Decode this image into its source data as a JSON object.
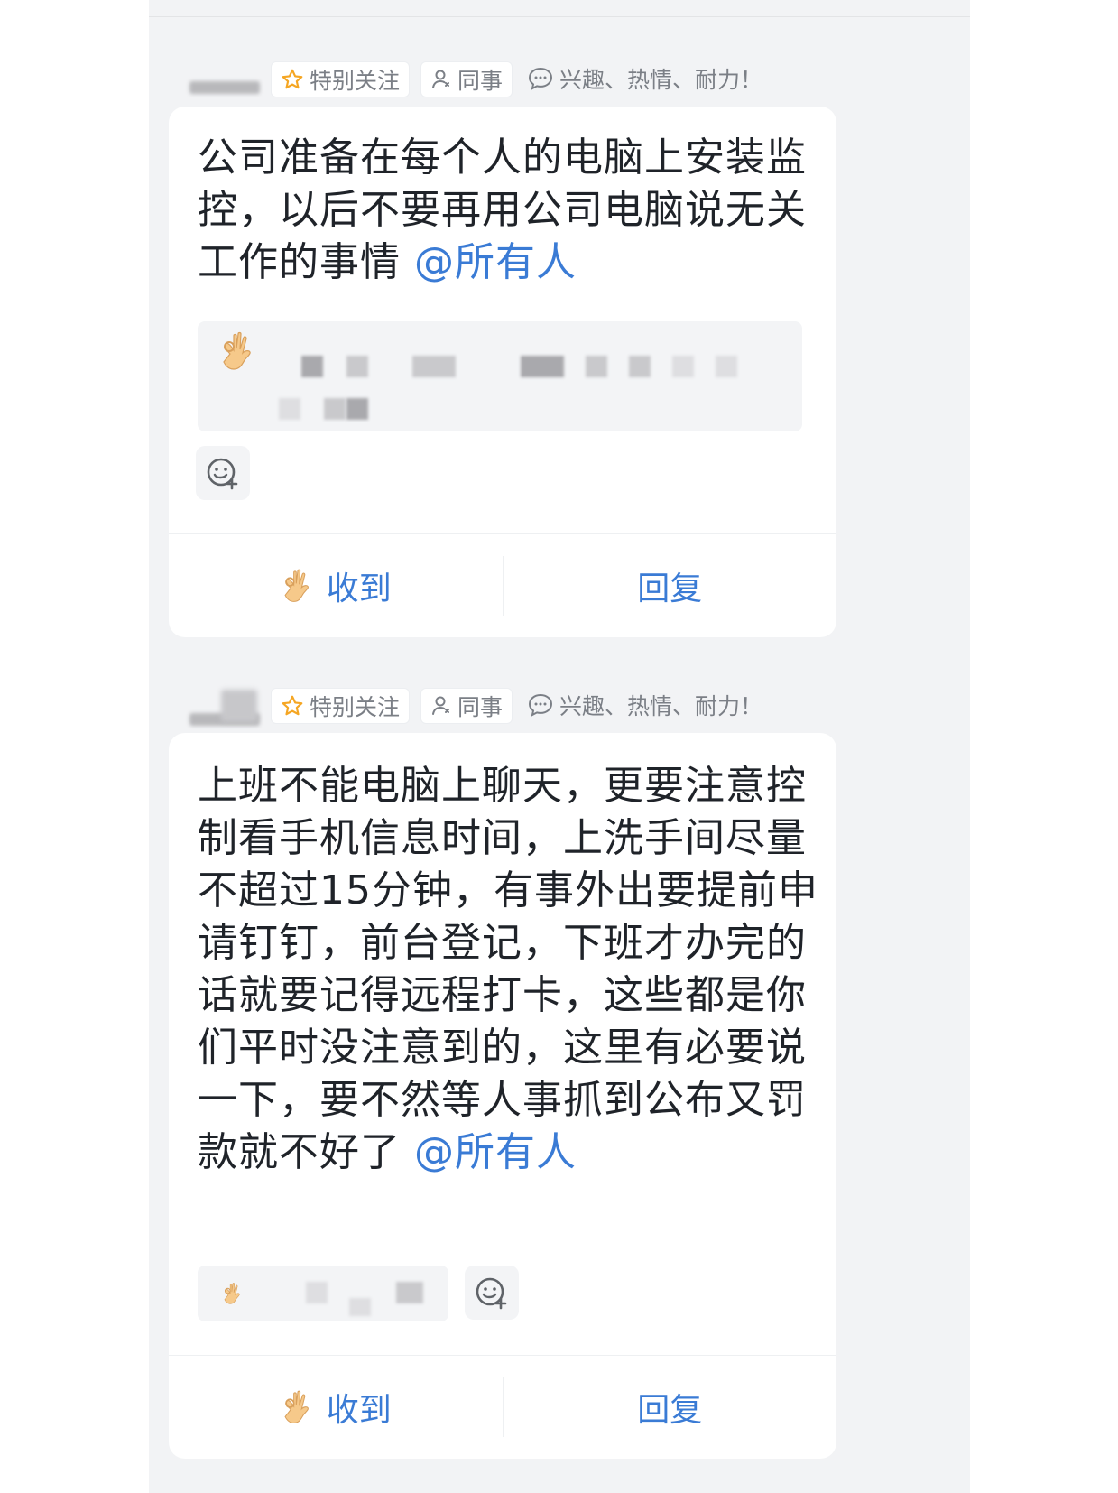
{
  "messages": [
    {
      "tags": {
        "special_follow": "特别关注",
        "colleague": "同事",
        "signature": "兴趣、热情、耐力！"
      },
      "text": "公司准备在每个人的电脑上安装监控，以后不要再用公司电脑说无关工作的事情",
      "mention": "@所有人",
      "reaction_icon": "ok-hand-icon",
      "footer": {
        "received_label": "收到",
        "reply_label": "回复"
      }
    },
    {
      "tags": {
        "special_follow": "特别关注",
        "colleague": "同事",
        "signature": "兴趣、热情、耐力！"
      },
      "text": "上班不能电脑上聊天，更要注意控制看手机信息时间，上洗手间尽量不超过15分钟，有事外出要提前申请钉钉，前台登记，下班才办完的话就要记得远程打卡，这些都是你们平时没注意到的，这里有必要说一下，要不然等人事抓到公布又罚款就不好了",
      "mention": "@所有人",
      "reaction_icon": "ok-hand-icon",
      "footer": {
        "received_label": "收到",
        "reply_label": "回复"
      }
    }
  ],
  "colors": {
    "accent": "#3a7bd5",
    "text": "#1f2329",
    "tag_text": "#7b7f86",
    "star": "#f5a623",
    "background": "#f2f3f5"
  }
}
